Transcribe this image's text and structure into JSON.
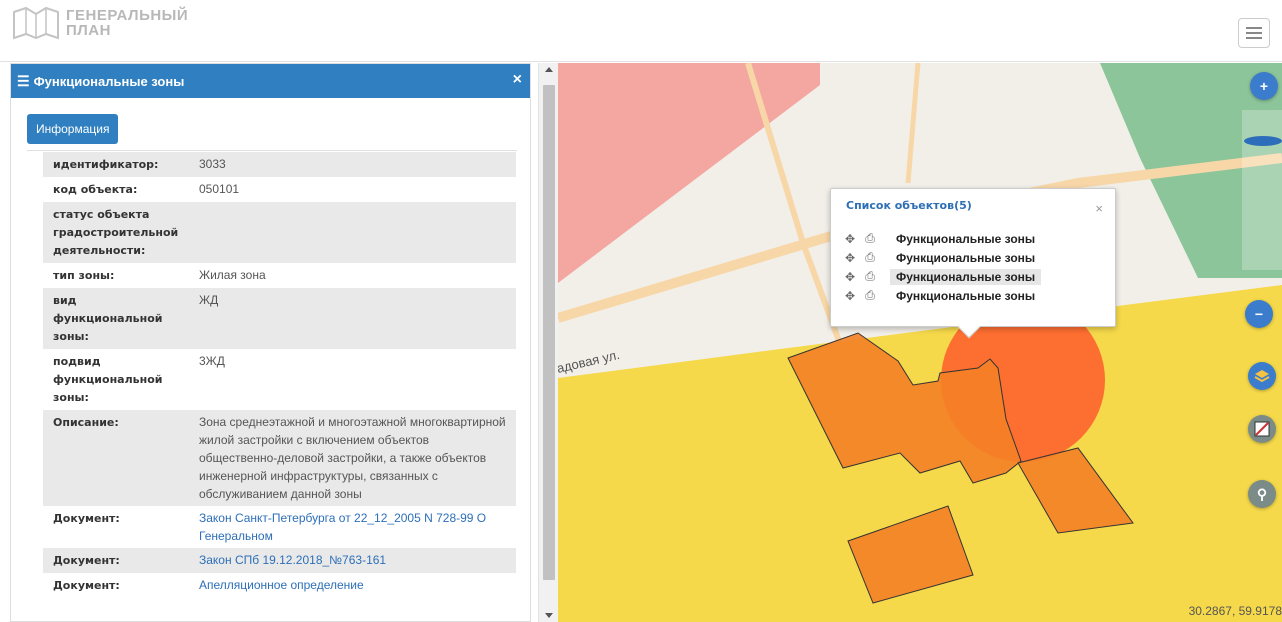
{
  "header": {
    "logo_line1": "ГЕНЕРАЛЬНЫЙ",
    "logo_line2": "ПЛАН",
    "menu_icon": "hamburger-icon"
  },
  "panel": {
    "title": "Функциональные зоны",
    "close": "×",
    "info_button": "Информация",
    "rows": [
      {
        "key": "идентификатор:",
        "value": "3033"
      },
      {
        "key": "код объекта:",
        "value": "050101"
      },
      {
        "key": "статус объекта градостроительной деятельности:",
        "value": ""
      },
      {
        "key": "тип зоны:",
        "value": "Жилая зона"
      },
      {
        "key": "вид функциональной зоны:",
        "value": "ЖД"
      },
      {
        "key": "подвид функциональной зоны:",
        "value": "3ЖД"
      },
      {
        "key": "Описание:",
        "value": "Зона среднеэтажной и многоэтажной многоквартирной жилой застройки с включением объектов общественно-деловой застройки, а также объектов инженерной инфраструктуры, связанных с обслуживанием данной зоны"
      },
      {
        "key": "Документ:",
        "value": "Закон Санкт-Петербурга от 22_12_2005 N 728-99 О Генеральном",
        "link": true
      },
      {
        "key": "Документ:",
        "value": "Закон СПб 19.12.2018_№763-161",
        "link": true
      },
      {
        "key": "Документ:",
        "value": "Апелляционное определение",
        "link": true
      }
    ]
  },
  "map": {
    "street_label": "адовая ул.",
    "coords": "30.2867, 59.9178",
    "controls": {
      "zoom_in": "+",
      "zoom_out": "−",
      "search": "search-icon",
      "layers": "layers-icon",
      "measure": "ruler-icon"
    },
    "colors": {
      "red_zone": "#f4a6a0",
      "yellow_zone": "#f5d94a",
      "green_zone": "#8cc59a",
      "building": "#f47f26",
      "highlight": "#ff4a2a"
    }
  },
  "popup": {
    "title": "Список объектов(5)",
    "close": "×",
    "items": [
      {
        "label": "Функциональные зоны",
        "selected": false
      },
      {
        "label": "Функциональные зоны",
        "selected": false
      },
      {
        "label": "Функциональные зоны",
        "selected": true
      },
      {
        "label": "Функциональные зоны",
        "selected": false
      }
    ]
  }
}
